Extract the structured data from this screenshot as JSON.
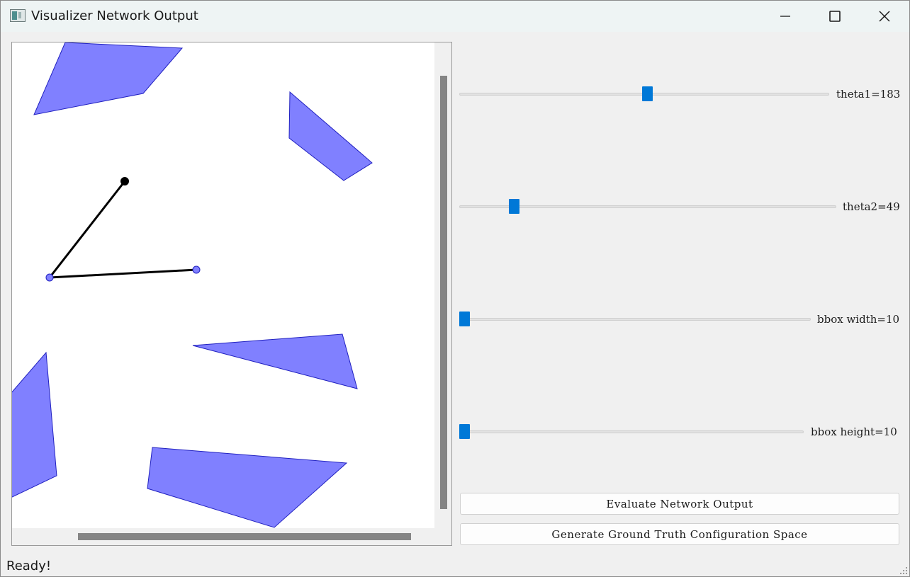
{
  "window": {
    "title": "Visualizer Network Output",
    "controls": [
      "minimize",
      "maximize",
      "close"
    ]
  },
  "sliders": [
    {
      "name": "theta1",
      "label": "theta1=183",
      "value": 183,
      "fraction": 0.51
    },
    {
      "name": "theta2",
      "label": "theta2=49",
      "value": 49,
      "fraction": 0.14
    },
    {
      "name": "bbox_width",
      "label": "bbox width=10",
      "value": 10,
      "fraction": 0.0
    },
    {
      "name": "bbox_height",
      "label": "bbox height=10",
      "value": 10,
      "fraction": 0.0
    }
  ],
  "buttons": {
    "evaluate": "Evaluate Network Output",
    "generate": "Generate Ground Truth Configuration Space"
  },
  "status": "Ready!",
  "colors": {
    "obstacle_fill": "#8080ff",
    "obstacle_stroke": "#2020c0",
    "arm": "#000000",
    "slider_handle": "#0078d7"
  },
  "icons": [
    "app-icon",
    "minimize-icon",
    "maximize-icon",
    "close-icon",
    "size-grip-icon"
  ]
}
